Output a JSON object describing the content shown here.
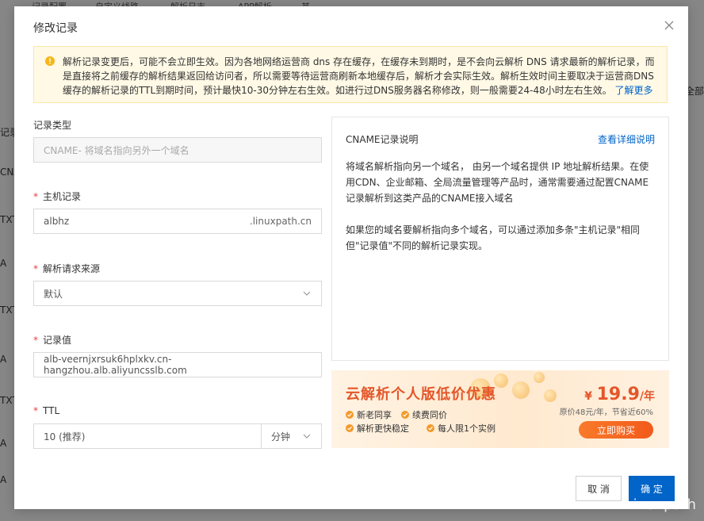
{
  "background": {
    "tabs": [
      "记录配置",
      "自定义线路",
      "解析日志",
      "APP解析",
      "其"
    ],
    "rows": [
      "记录",
      "CNA",
      "TXT",
      "A",
      "TXT",
      "A",
      "TXT",
      "A",
      "A"
    ],
    "right_text": "全部"
  },
  "modal": {
    "title": "修改记录",
    "notice": {
      "text": "解析记录变更后，可能不会立即生效。因为各地网络运营商 dns 存在缓存，在缓存未到期时，是不会向云解析 DNS 请求最新的解析记录，而是直接将之前缓存的解析结果返回给访问者，所以需要等待运营商刷新本地缓存后，解析才会实际生效。解析生效时间主要取决于运营商DNS缓存的解析记录的TTL到期时间，预计最快10-30分钟左右生效。如进行过DNS服务器名称修改，则一般需要24-48小时左右生效。",
      "link": "了解更多"
    },
    "form": {
      "record_type": {
        "label": "记录类型",
        "value": "CNAME- 将域名指向另外一个域名"
      },
      "host": {
        "label": "主机记录",
        "value": "albhz",
        "suffix": ".linuxpath.cn"
      },
      "line": {
        "label": "解析请求来源",
        "value": "默认"
      },
      "value": {
        "label": "记录值",
        "value": "alb-veernjxrsuk6hplxkv.cn-hangzhou.alb.aliyuncsslb.com"
      },
      "ttl": {
        "label": "TTL",
        "value": "10 (推荐)",
        "unit": "分钟"
      }
    },
    "info": {
      "title": "CNAME记录说明",
      "more_link": "查看详细说明",
      "p1": "将域名解析指向另一个域名， 由另一个域名提供 IP 地址解析结果。在使用CDN、企业邮箱、全局流量管理等产品时，通常需要通过配置CNAME记录解析到这类产品的CNAME接入域名",
      "p2": "如果您的域名要解析指向多个域名，可以通过添加多条\"主机记录\"相同但\"记录值\"不同的解析记录实现。"
    },
    "promo": {
      "title": "云解析个人版低价优惠",
      "features": [
        "新老同享",
        "续费同价",
        "解析更快稳定",
        "每人限1个实例"
      ],
      "price_currency": "¥",
      "price_value": "19.9",
      "price_unit": "/年",
      "original": "原价48元/年，节省近60%",
      "buy_label": "立即购买",
      "accent": "#e4562a"
    },
    "buttons": {
      "cancel": "取 消",
      "ok": "确 定"
    }
  },
  "watermark": "Linuxpath",
  "colors": {
    "primary": "#0064c8",
    "required": "#f23c3c",
    "notice_bg": "#fff9e6"
  }
}
